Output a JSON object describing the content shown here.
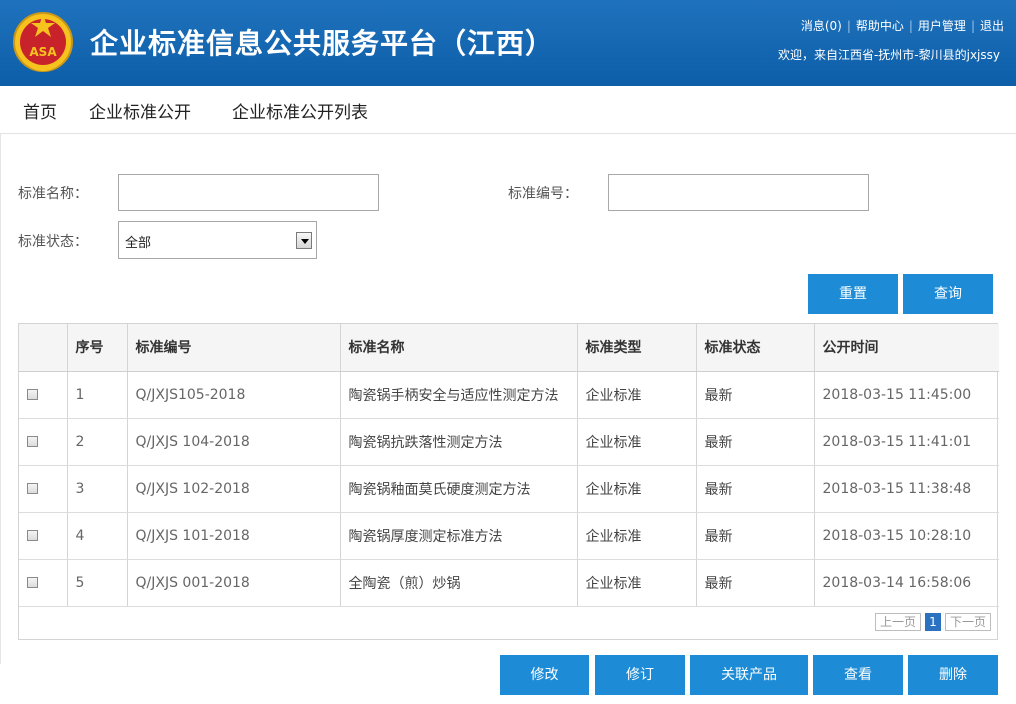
{
  "header": {
    "title": "企业标准信息公共服务平台（江西）",
    "links": [
      "消息(0)",
      "帮助中心",
      "用户管理",
      "退出"
    ],
    "welcome": "欢迎，来自江西省-抚州市-黎川县的jxjssy",
    "emblem_text": "ASA"
  },
  "nav": [
    "首页",
    "企业标准公开",
    "企业标准公开列表"
  ],
  "form": {
    "name_label": "标准名称：",
    "name_value": "",
    "code_label": "标准编号：",
    "code_value": "",
    "status_label": "标准状态：",
    "status_value": "全部"
  },
  "search_buttons": {
    "reset": "重置",
    "query": "查询"
  },
  "table": {
    "headers": [
      "",
      "序号",
      "标准编号",
      "标准名称",
      "标准类型",
      "标准状态",
      "公开时间"
    ],
    "rows": [
      {
        "no": "1",
        "code": "Q/JXJS105-2018",
        "name": "陶瓷锅手柄安全与适应性测定方法",
        "type": "企业标准",
        "status": "最新",
        "time": "2018-03-15 11:45:00"
      },
      {
        "no": "2",
        "code": "Q/JXJS 104-2018",
        "name": "陶瓷锅抗跌落性测定方法",
        "type": "企业标准",
        "status": "最新",
        "time": "2018-03-15 11:41:01"
      },
      {
        "no": "3",
        "code": "Q/JXJS 102-2018",
        "name": "陶瓷锅釉面莫氏硬度测定方法",
        "type": "企业标准",
        "status": "最新",
        "time": "2018-03-15 11:38:48"
      },
      {
        "no": "4",
        "code": "Q/JXJS 101-2018",
        "name": "陶瓷锅厚度测定标准方法",
        "type": "企业标准",
        "status": "最新",
        "time": "2018-03-15 10:28:10"
      },
      {
        "no": "5",
        "code": "Q/JXJS 001-2018",
        "name": "全陶瓷（煎）炒锅",
        "type": "企业标准",
        "status": "最新",
        "time": "2018-03-14 16:58:06"
      }
    ]
  },
  "pager": {
    "prev": "上一页",
    "current": "1",
    "next": "下一页"
  },
  "actions": [
    "修改",
    "修订",
    "关联产品",
    "查看",
    "删除"
  ],
  "colors": {
    "header_blue": "#1467b3",
    "button_blue": "#1d8bd6",
    "page_current": "#2b73c0"
  }
}
